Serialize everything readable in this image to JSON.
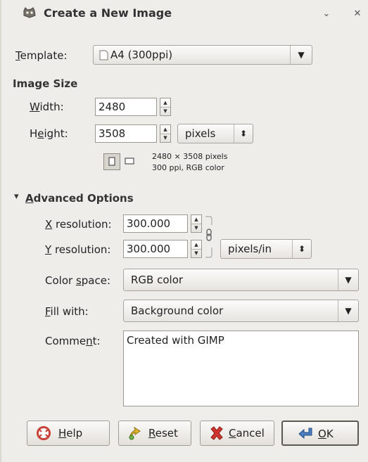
{
  "window": {
    "title": "Create a New Image",
    "icons": {
      "app": "gimp-icon",
      "shade": "chevron-down-icon",
      "close": "close-icon"
    },
    "close_glyph": "✕",
    "shade_glyph": "⌄"
  },
  "template": {
    "label": "Template:",
    "label_mnemonic": "T",
    "label_rest": "emplate:",
    "value": "A4 (300ppi)",
    "arrow": "▼"
  },
  "image_size": {
    "heading": "Image Size",
    "width_label_mn": "W",
    "width_label_rest": "idth:",
    "width_value": "2480",
    "height_label_pre": "H",
    "height_label_mn": "e",
    "height_label_rest": "ight:",
    "height_value": "3508",
    "unit": "pixels",
    "unit_arrow": "⬍",
    "info_line1": "2480 × 3508 pixels",
    "info_line2": "300 ppi, RGB color"
  },
  "advanced": {
    "expander_glyph": "▾",
    "heading_mn": "A",
    "heading_rest": "dvanced Options",
    "xres_label_mn": "X",
    "xres_label_rest": " resolution:",
    "xres_value": "300.000",
    "yres_label_mn": "Y",
    "yres_label_rest": " resolution:",
    "yres_value": "300.000",
    "res_unit": "pixels/in",
    "res_unit_arrow": "⬍",
    "colorspace_label_pre": "Color ",
    "colorspace_label_mn": "s",
    "colorspace_label_rest": "pace:",
    "colorspace_value": "RGB color",
    "fill_label_mn": "F",
    "fill_label_rest": "ill with:",
    "fill_value": "Background color",
    "comment_label_pre": "Comme",
    "comment_label_mn": "n",
    "comment_label_rest": "t:",
    "comment_value": "Created with GIMP",
    "arrow": "▼"
  },
  "buttons": {
    "help_mn": "H",
    "help_rest": "elp",
    "reset_mn": "R",
    "reset_rest": "eset",
    "cancel_mn": "C",
    "cancel_rest": "ancel",
    "ok_mn": "O",
    "ok_rest": "K"
  },
  "colors": {
    "background": "#efedea",
    "cancel_icon": "#d0342c",
    "ok_icon": "#4a7fc1",
    "reset_icon": "#e0b72a",
    "help_icon": "#c8433a"
  }
}
